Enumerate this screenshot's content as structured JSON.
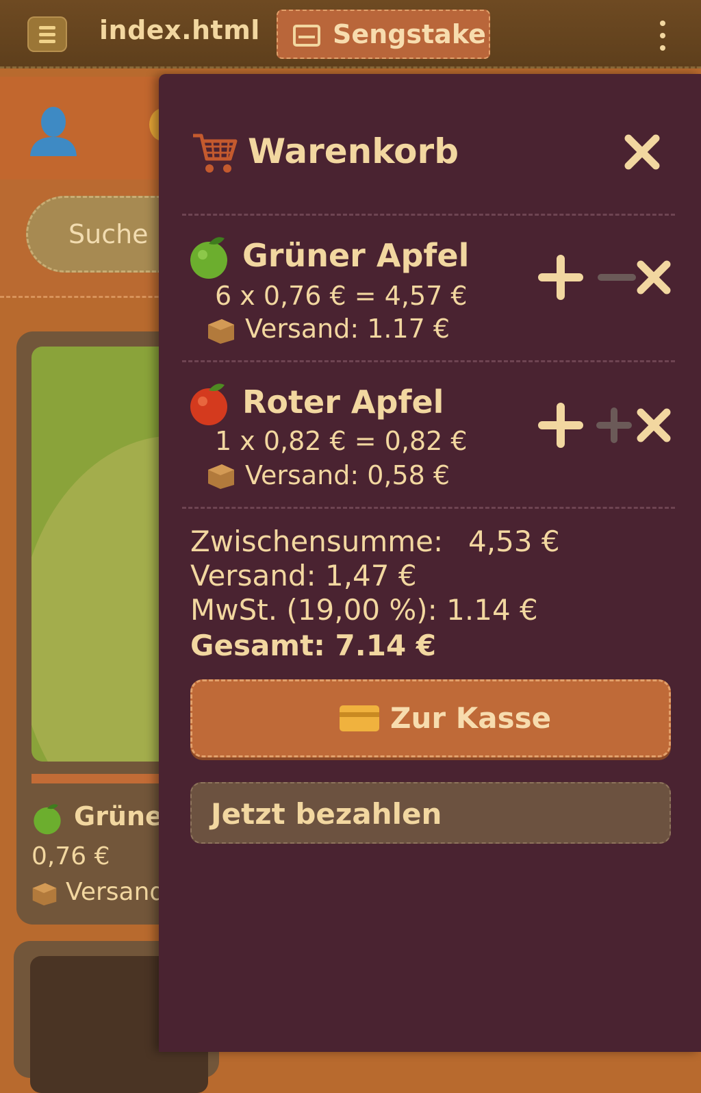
{
  "topbar": {
    "menu_icon": "hamburger-menu-icon",
    "file_title": "index.html",
    "active_tab_label": "Sengstake",
    "more_icon": "vertical-dots-icon"
  },
  "background_page": {
    "search_placeholder": "Suche n",
    "product_card": {
      "name": "Grüner",
      "price": "0,76 €",
      "shipping": "Versand"
    }
  },
  "cart": {
    "title": "Warenkorb",
    "items": [
      {
        "name": "Grüner Apfel",
        "apple_color": "#6cae2e",
        "calc": "6 x 0,76 € = 4,57 €",
        "shipping": "Versand: 1.17 €",
        "controls": {
          "plus": "+",
          "minus": "−",
          "remove": "×"
        }
      },
      {
        "name": "Roter Apfel",
        "apple_color": "#d43a1e",
        "calc": "1 x 0,82 € = 0,82 €",
        "shipping": "Versand: 0,58 €",
        "controls": {
          "plus": "+",
          "second_plus": "+",
          "remove": "×"
        }
      }
    ],
    "summary": {
      "subtotal_label": "Zwischensumme:",
      "subtotal_value": "4,53 €",
      "shipping": "Versand: 1,47 €",
      "vat": "MwSt. (19,00 %): 1.14 €",
      "total": "Gesamt: 7.14 €"
    },
    "checkout_label": "Zur Kasse",
    "pay_now_label": "Jetzt bezahlen"
  },
  "colors": {
    "drawer_bg": "#4a2331",
    "accent_orange": "#bf6a38",
    "text_cream": "#f2d7a0"
  }
}
